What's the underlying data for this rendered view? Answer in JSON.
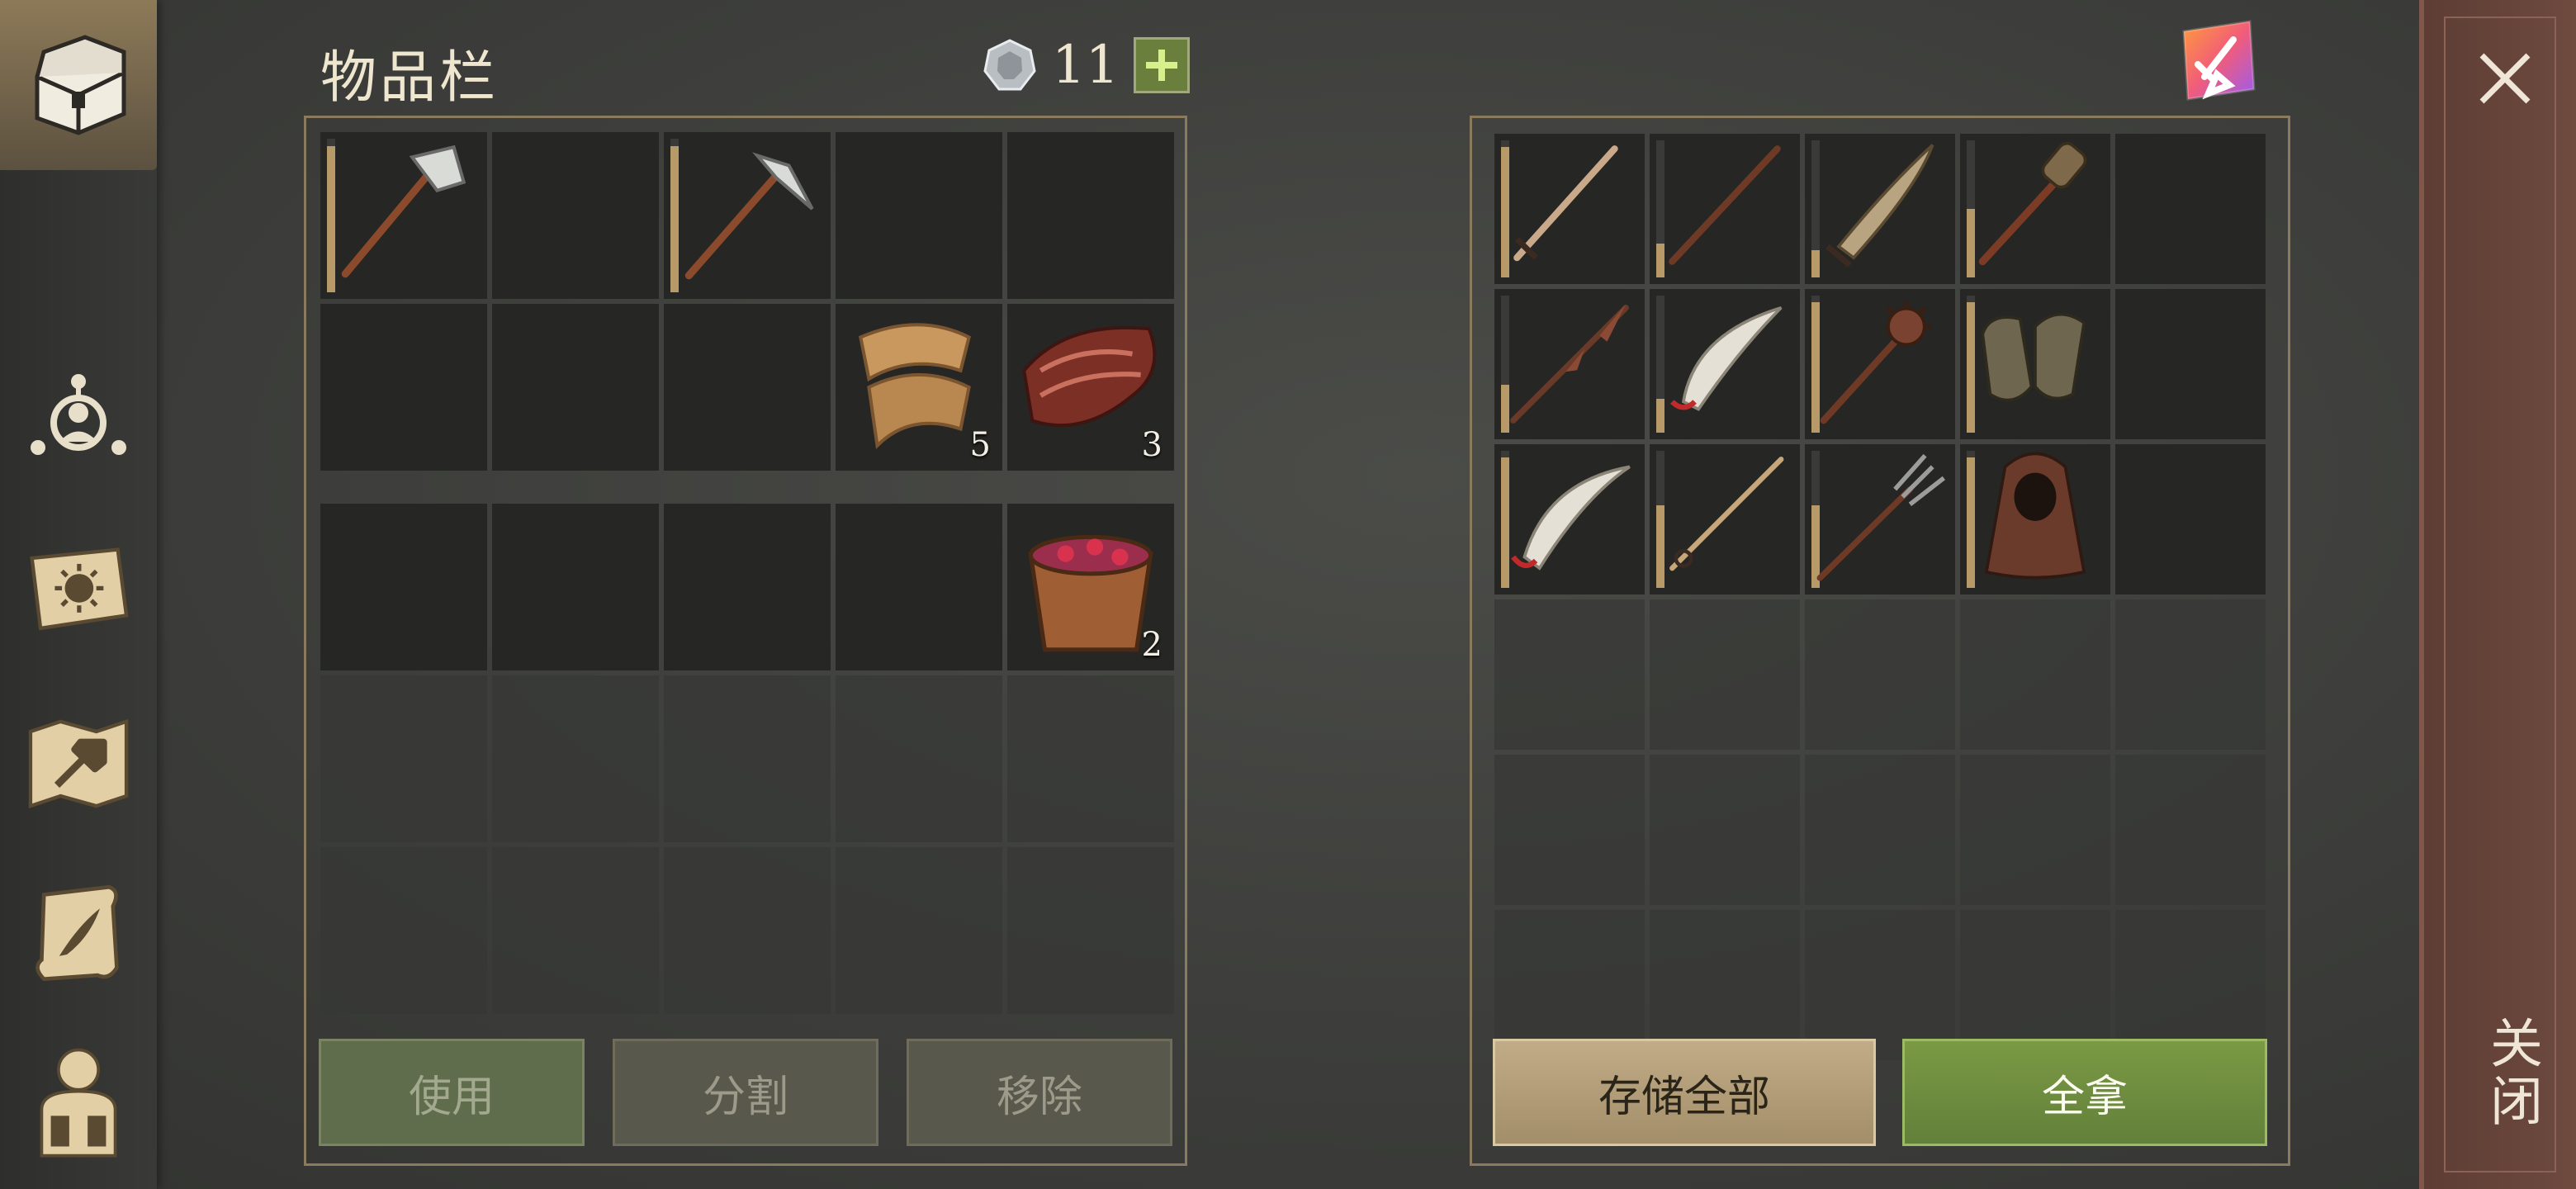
{
  "inventory": {
    "title": "物品栏",
    "currency_count": "11",
    "plus_icon": "plus-icon",
    "grid_rows": [
      [
        {
          "item": "stone-hatchet",
          "durability": 0.95
        },
        {
          "item": ""
        },
        {
          "item": "stone-pickaxe",
          "durability": 0.95
        },
        {
          "item": ""
        },
        {
          "item": ""
        }
      ],
      [
        {
          "item": ""
        },
        {
          "item": ""
        },
        {
          "item": ""
        },
        {
          "item": "leather-strips",
          "count": "5"
        },
        {
          "item": "raw-meat",
          "count": "3"
        }
      ],
      [
        {
          "item": ""
        },
        {
          "item": ""
        },
        {
          "item": ""
        },
        {
          "item": ""
        },
        {
          "item": "berry-bucket",
          "count": "2"
        }
      ]
    ],
    "locked_rows": 2,
    "buttons": {
      "use": "使用",
      "split": "分割",
      "remove": "移除"
    }
  },
  "storage": {
    "sort_icon": "sort-broom-icon",
    "grid_rows": [
      [
        {
          "item": "longsword",
          "durability": 0.95
        },
        {
          "item": "wooden-staff",
          "durability": 0.25
        },
        {
          "item": "falchion",
          "durability": 0.2
        },
        {
          "item": "torch-club",
          "durability": 0.5
        },
        {
          "item": ""
        }
      ],
      [
        {
          "item": "spiked-spear",
          "durability": 0.35
        },
        {
          "item": "scimitar",
          "durability": 0.25
        },
        {
          "item": "morning-star",
          "durability": 0.95
        },
        {
          "item": "leather-gloves",
          "durability": 0.95
        },
        {
          "item": ""
        }
      ],
      [
        {
          "item": "curved-sabre",
          "durability": 0.95
        },
        {
          "item": "rapier",
          "durability": 0.6
        },
        {
          "item": "pitchfork",
          "durability": 0.6
        },
        {
          "item": "hooded-cloak",
          "durability": 0.95
        },
        {
          "item": ""
        }
      ]
    ],
    "locked_rows": 3,
    "buttons": {
      "store_all": "存储全部",
      "take_all": "全拿"
    }
  },
  "sidebar": {
    "items": [
      {
        "icon": "chest-icon"
      },
      {
        "icon": "character-skills-icon"
      },
      {
        "icon": "sun-tome-icon"
      },
      {
        "icon": "crafting-map-icon"
      },
      {
        "icon": "scroll-quill-icon"
      },
      {
        "icon": "backpack-character-icon"
      }
    ]
  },
  "close": {
    "label": "关闭",
    "icon": "close-icon"
  },
  "colors": {
    "panel_border": "#8a7b5f",
    "take_green": "#6f8d40",
    "store_tan": "#b39e79",
    "rail_red": "#6a463c"
  }
}
